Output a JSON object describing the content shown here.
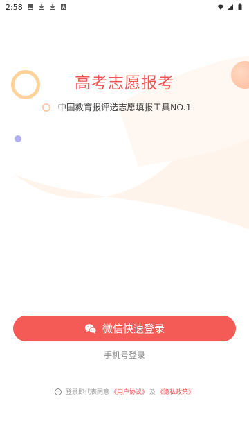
{
  "status_bar": {
    "time": "2:58",
    "icons_left": [
      "image-icon",
      "download-icon",
      "download-icon",
      "app-a-icon"
    ],
    "icons_right": [
      "wifi-icon",
      "signal-icon",
      "battery-icon"
    ]
  },
  "header": {
    "title": "高考志愿报考",
    "subtitle": "中国教育报评选志愿填报工具NO.1"
  },
  "login": {
    "wechat_button": "微信快速登录",
    "phone_login": "手机号登录"
  },
  "agreement": {
    "prefix": "登录即代表同意",
    "user_agreement": "《用户协议》",
    "and": "及",
    "privacy_policy": "《隐私政策》"
  },
  "colors": {
    "accent": "#f45b57",
    "title": "#f25350",
    "muted": "#8a8a8a"
  }
}
